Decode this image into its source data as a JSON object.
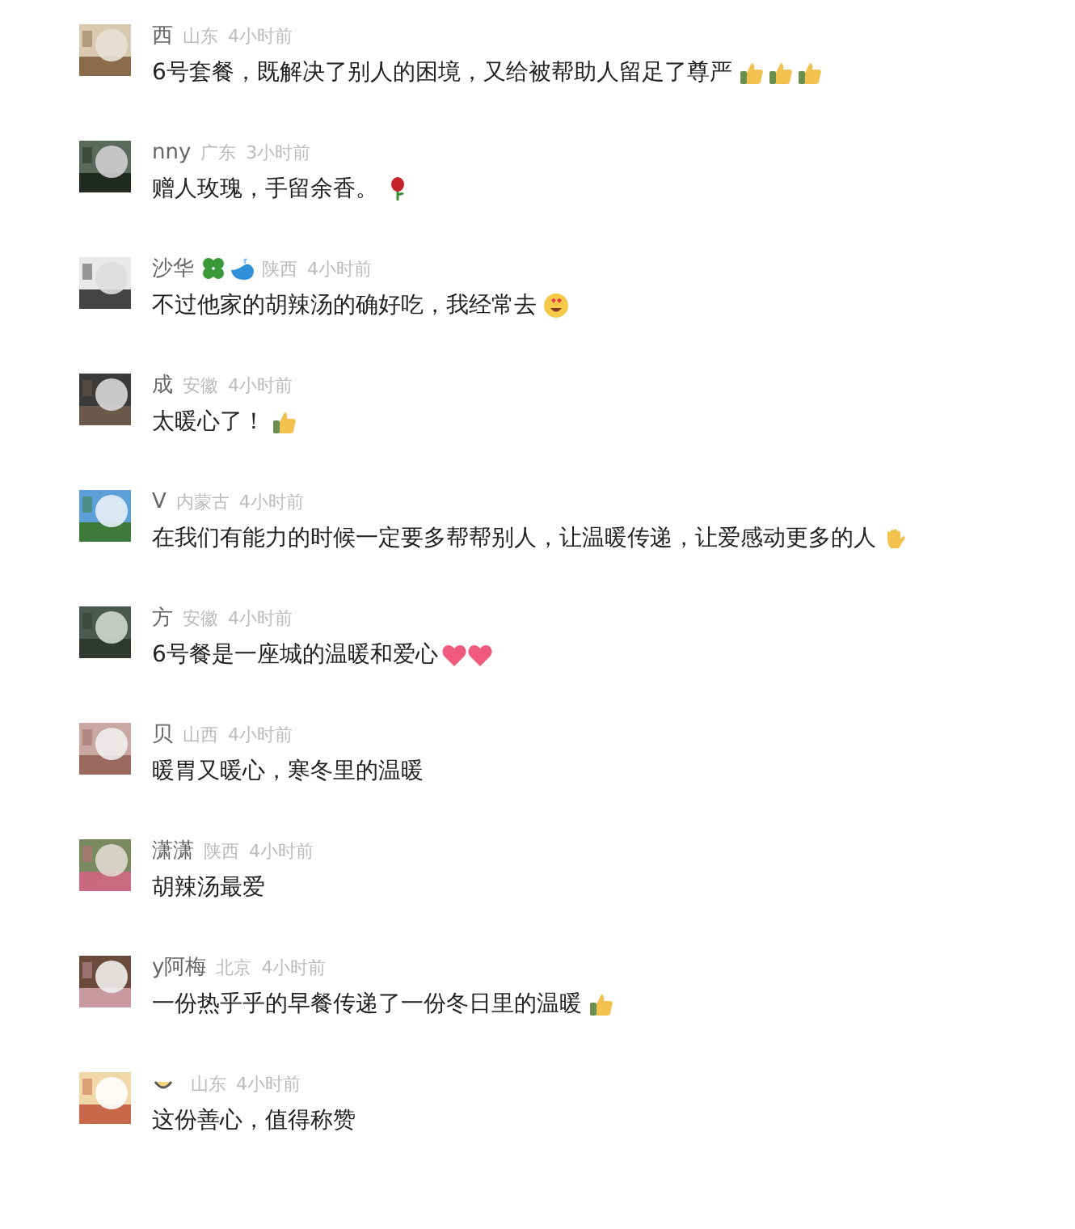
{
  "comments": [
    {
      "name": "西",
      "location": "山东",
      "time": "4小时前",
      "text": "6号套餐，既解决了别人的困境，又给被帮助人留足了尊严",
      "emojis": [
        {
          "kind": "thumbs"
        },
        {
          "kind": "thumbs"
        },
        {
          "kind": "thumbs"
        }
      ]
    },
    {
      "name": "nny",
      "location": "广东",
      "time": "3小时前",
      "text": "赠人玫瑰，手留余香。",
      "emojis": [
        {
          "kind": "rose"
        }
      ]
    },
    {
      "name": "沙华",
      "location": "陕西",
      "time": "4小时前",
      "text": "不过他家的胡辣汤的确好吃，我经常去",
      "name_icons": [
        {
          "kind": "clover"
        },
        {
          "kind": "whale"
        }
      ],
      "emojis": [
        {
          "kind": "heart-eyes"
        }
      ]
    },
    {
      "name": "成",
      "location": "安徽",
      "time": "4小时前",
      "text": "太暖心了！",
      "emojis": [
        {
          "kind": "thumbs"
        }
      ]
    },
    {
      "name": "V",
      "location": "内蒙古",
      "time": "4小时前",
      "text": "在我们有能力的时候一定要多帮帮别人，让温暖传递，让爱感动更多的人",
      "emojis": [
        {
          "kind": "hand"
        }
      ]
    },
    {
      "name": "方",
      "location": "安徽",
      "time": "4小时前",
      "text": "6号餐是一座城的温暖和爱心",
      "emojis": [
        {
          "kind": "heart"
        },
        {
          "kind": "heart"
        }
      ]
    },
    {
      "name": "贝",
      "location": "山西",
      "time": "4小时前",
      "text": "暖胃又暖心，寒冬里的温暖"
    },
    {
      "name": "潇潇",
      "location": "陕西",
      "time": "4小时前",
      "text": "胡辣汤最爱"
    },
    {
      "name": "y阿梅",
      "location": "北京",
      "time": "4小时前",
      "text": "一份热乎乎的早餐传递了一份冬日里的温暖",
      "emojis": [
        {
          "kind": "thumbs"
        }
      ]
    },
    {
      "location": "山东",
      "time": "4小时前",
      "text": "这份善心，值得称赞",
      "name_icons": [
        {
          "kind": "smile"
        }
      ]
    }
  ]
}
